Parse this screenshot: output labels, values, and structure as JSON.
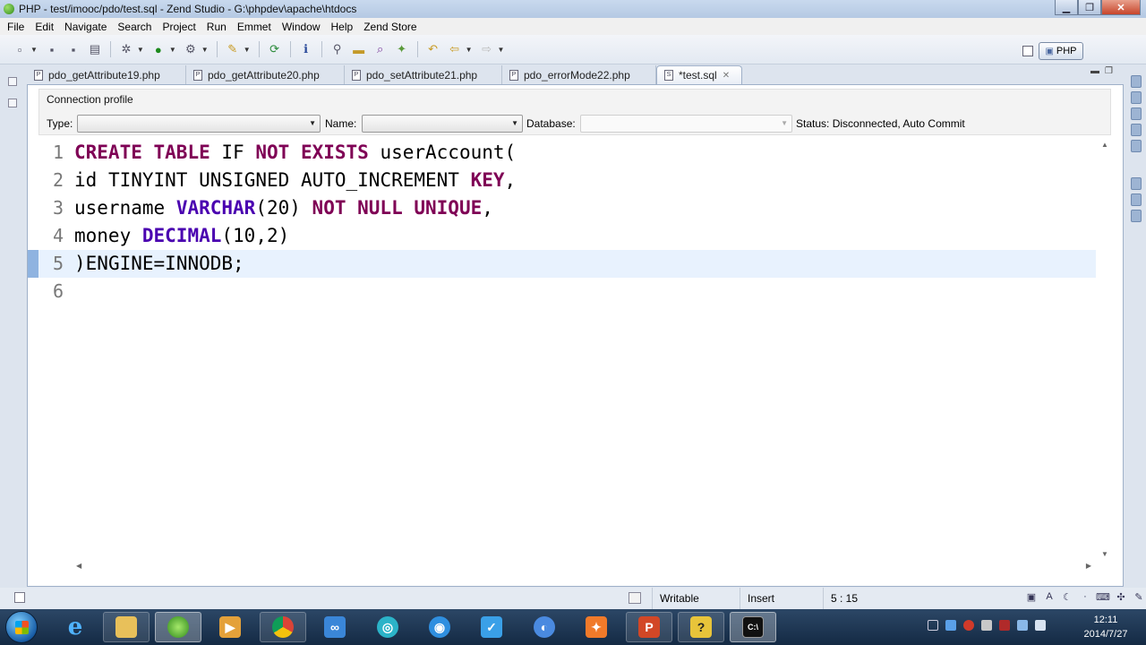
{
  "window": {
    "title": "PHP - test/imooc/pdo/test.sql - Zend Studio - G:\\phpdev\\apache\\htdocs"
  },
  "menu": [
    "File",
    "Edit",
    "Navigate",
    "Search",
    "Project",
    "Run",
    "Emmet",
    "Window",
    "Help",
    "Zend Store"
  ],
  "perspective": {
    "label": "PHP"
  },
  "tabs": [
    {
      "label": "pdo_getAttribute19.php",
      "active": false
    },
    {
      "label": "pdo_getAttribute20.php",
      "active": false
    },
    {
      "label": "pdo_setAttribute21.php",
      "active": false
    },
    {
      "label": "pdo_errorMode22.php",
      "active": false
    },
    {
      "label": "*test.sql",
      "active": true
    }
  ],
  "connection": {
    "heading": "Connection profile",
    "type_label": "Type:",
    "type_value": "",
    "name_label": "Name:",
    "name_value": "",
    "database_label": "Database:",
    "database_value": "",
    "status": "Status: Disconnected, Auto Commit"
  },
  "editor": {
    "current_line": 5,
    "lines": [
      {
        "n": "1",
        "text": "CREATE TABLE IF NOT EXISTS userAccount("
      },
      {
        "n": "2",
        "text": "id TINYINT UNSIGNED AUTO_INCREMENT KEY,"
      },
      {
        "n": "3",
        "text": "username VARCHAR(20) NOT NULL UNIQUE,"
      },
      {
        "n": "4",
        "text": "money DECIMAL(10,2)"
      },
      {
        "n": "5",
        "text": ")ENGINE=INNODB;"
      },
      {
        "n": "6",
        "text": ""
      }
    ]
  },
  "status": {
    "writable": "Writable",
    "insert_mode": "Insert",
    "cursor": "5 : 15"
  },
  "taskbar": {
    "apps": [
      "start-button",
      "internet-explorer",
      "file-explorer",
      "zend-studio",
      "media-player",
      "chrome",
      "network-tool",
      "browser-360",
      "video-app",
      "messenger",
      "qq-browser",
      "browser-orange",
      "powerpoint",
      "help-app",
      "command-prompt"
    ],
    "clock_time": "12:11",
    "clock_date": "2014/7/27"
  },
  "colors": {
    "keyword": "#7f0055",
    "type": "#4a00b0",
    "current_line_bg": "#e8f2fe"
  }
}
